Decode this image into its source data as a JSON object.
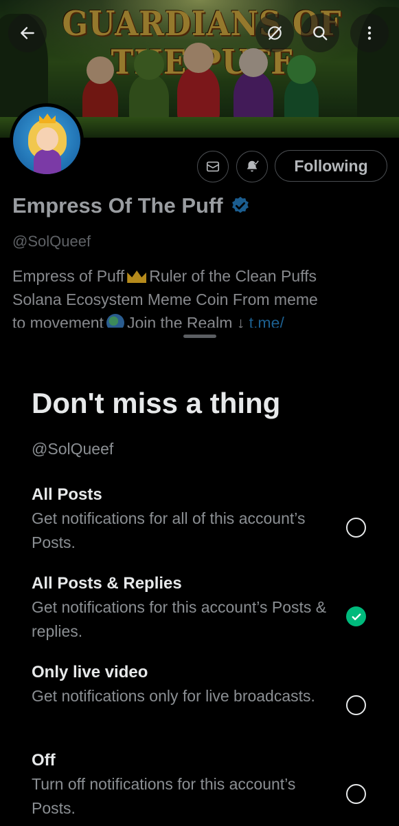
{
  "banner": {
    "title": "GUARDIANS OF THE PUFF",
    "colors": {
      "title": "#f1c44a",
      "forest": "#3f6b22"
    }
  },
  "topbar": {
    "back_icon": "arrow-left-icon",
    "privacy_icon": "slashed-circle-icon",
    "search_icon": "search-icon",
    "more_icon": "more-vertical-icon"
  },
  "profile": {
    "display_name": "Empress Of The Puff",
    "verified": true,
    "handle": "@SolQueef",
    "bio_line1_a": "Empress of Puff",
    "bio_line1_b": "Ruler of the Clean Puffs",
    "bio_line2": "Solana Ecosystem Meme Coin From meme",
    "bio_line3_a": "to movement",
    "bio_line3_b": "Join the Realm ↓",
    "bio_link": "t.me/",
    "actions": {
      "message_icon": "envelope-icon",
      "notify_icon": "bell-check-icon",
      "following_label": "Following"
    }
  },
  "sheet": {
    "title": "Don't miss a thing",
    "handle": "@SolQueef",
    "options": [
      {
        "title": "All Posts",
        "desc": "Get notifications for all of this account’s Posts.",
        "selected": false
      },
      {
        "title": "All Posts & Replies",
        "desc": "Get notifications for this account’s Posts & replies.",
        "selected": true
      },
      {
        "title": "Only live video",
        "desc": "Get notifications only for live broadcasts.",
        "selected": false
      },
      {
        "title": "Off",
        "desc": "Turn off notifications for this account’s Posts.",
        "selected": false
      }
    ],
    "colors": {
      "selected": "#00ba7c",
      "background": "#000000"
    }
  }
}
